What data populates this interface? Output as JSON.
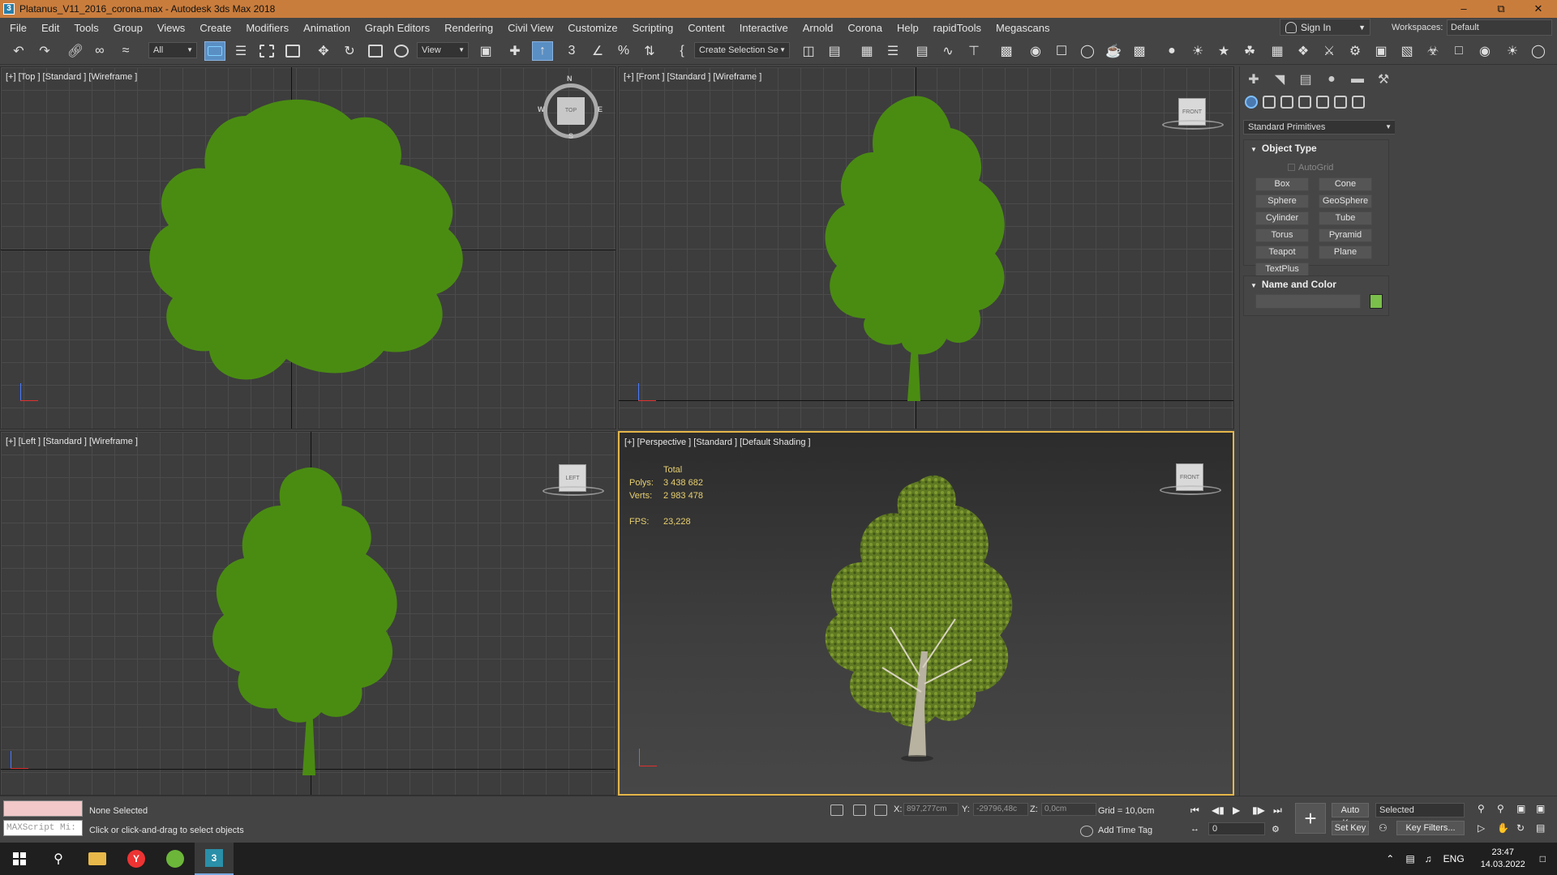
{
  "window": {
    "title": "Platanus_V11_2016_corona.max - Autodesk 3ds Max 2018",
    "icon_letter": "3"
  },
  "menu": [
    "File",
    "Edit",
    "Tools",
    "Group",
    "Views",
    "Create",
    "Modifiers",
    "Animation",
    "Graph Editors",
    "Rendering",
    "Civil View",
    "Customize",
    "Scripting",
    "Content",
    "Interactive",
    "Arnold",
    "Corona",
    "Help",
    "rapidTools",
    "Megascans"
  ],
  "account": {
    "sign_in": "Sign In",
    "workspaces_label": "Workspaces:",
    "workspace": "Default"
  },
  "toolbar": {
    "filter": "All",
    "ref_coord": "View",
    "selection_set": "Create Selection Se"
  },
  "viewports": {
    "top": {
      "label": "[+] [Top ] [Standard ] [Wireframe ]",
      "cube": "TOP",
      "compass": {
        "n": "N",
        "s": "S",
        "e": "E",
        "w": "W"
      }
    },
    "front": {
      "label": "[+] [Front ] [Standard ] [Wireframe ]",
      "cube": "FRONT"
    },
    "left": {
      "label": "[+] [Left ] [Standard ] [Wireframe ]",
      "cube": "LEFT"
    },
    "persp": {
      "label": "[+] [Perspective ] [Standard ] [Default Shading ]",
      "cube": "FRONT",
      "stats": {
        "total": "Total",
        "polys_label": "Polys:",
        "polys": "3 438 682",
        "verts_label": "Verts:",
        "verts": "2 983 478",
        "fps_label": "FPS:",
        "fps": "23,228"
      }
    }
  },
  "command_panel": {
    "category": "Standard Primitives",
    "object_type": {
      "title": "Object Type",
      "autogrid": "AutoGrid",
      "buttons": [
        "Box",
        "Cone",
        "Sphere",
        "GeoSphere",
        "Cylinder",
        "Tube",
        "Torus",
        "Pyramid",
        "Teapot",
        "Plane",
        "TextPlus"
      ]
    },
    "name_color": {
      "title": "Name and Color",
      "color": "#7ac04a"
    }
  },
  "status": {
    "maxscript": "MAXScript Mi:",
    "selection": "None Selected",
    "prompt": "Click or click-and-drag to select objects",
    "x_label": "X:",
    "x": "897,277cm",
    "y_label": "Y:",
    "y": "-29796,48c",
    "z_label": "Z:",
    "z": "0,0cm",
    "grid": "Grid = 10,0cm",
    "add_time_tag": "Add Time Tag",
    "frame": "0",
    "auto_key": "Auto Key",
    "set_key": "Set Key",
    "key_mode": "Selected",
    "key_filters": "Key Filters..."
  },
  "taskbar": {
    "lang": "ENG",
    "time": "23:47",
    "date": "14.03.2022"
  },
  "colors": {
    "tree_flat": "#4a8c12",
    "tree_shaded": "#5f7a22",
    "title_bar": "#c97d3d",
    "active_border": "#e5b74a"
  }
}
